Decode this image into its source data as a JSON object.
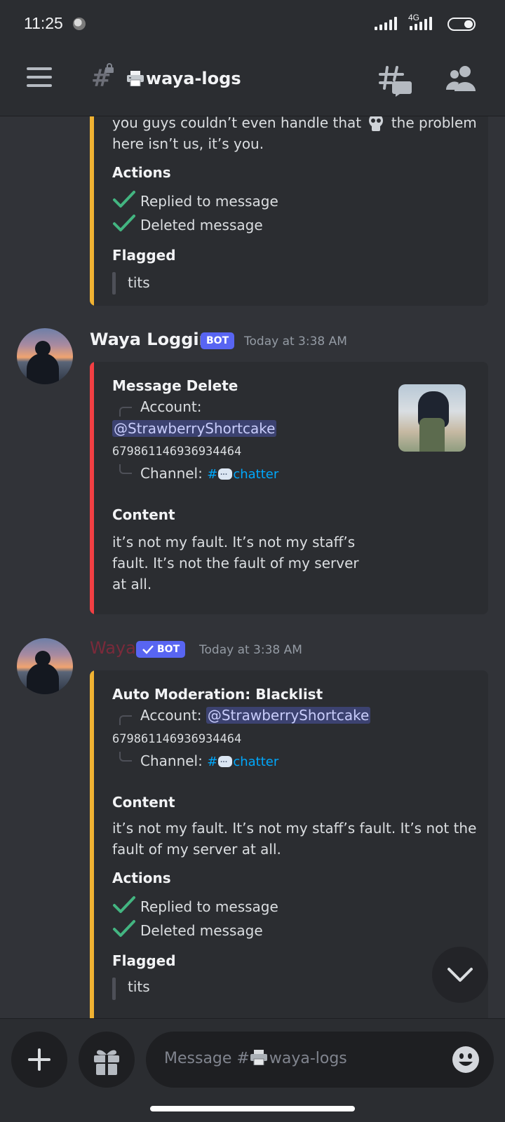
{
  "status_bar": {
    "time": "11:25",
    "network": "4G"
  },
  "header": {
    "channel_name": "waya-logs",
    "icons": [
      "menu-icon",
      "locked-channel-hash-icon",
      "printer-emoji",
      "threads-icon",
      "members-icon"
    ]
  },
  "messages": [
    {
      "partial_embed": {
        "content_tail_1": "you guys couldn’t even handle that",
        "content_tail_1b": "the problem",
        "content_tail_2": "here isn’t us, it’s you.",
        "actions_title": "Actions",
        "actions": [
          "Replied to message",
          "Deleted message"
        ],
        "flagged_title": "Flagged",
        "flagged_word": "tits",
        "bar_color": "#f0b232"
      }
    },
    {
      "author": "Waya Logging",
      "bot_tag": "BOT",
      "timestamp": "Today at 3:38 AM",
      "embed": {
        "title": "Message Delete",
        "account_label": "Account:",
        "account_mention": "@StrawberryShortcake",
        "account_id": "679861146936934464",
        "channel_label": "Channel:",
        "channel_hash": "#",
        "channel_name": "chatter",
        "content_title": "Content",
        "content_lines": [
          "it’s not my fault. It’s not my staff’s",
          "fault. It’s not the fault of my server",
          "at all."
        ],
        "bar_color": "#f23f43"
      }
    },
    {
      "author": "Waya",
      "bot_tag": "BOT",
      "timestamp": "Today at 3:38 AM",
      "embed": {
        "title": "Auto Moderation: Blacklist",
        "account_label": "Account:",
        "account_mention": "@StrawberryShortcake",
        "account_id": "679861146936934464",
        "channel_label": "Channel:",
        "channel_hash": "#",
        "channel_name": "chatter",
        "content_title": "Content",
        "content_lines": [
          "it’s not my fault. It’s not my staff’s fault. It’s not the",
          "fault of my server at all."
        ],
        "actions_title": "Actions",
        "actions": [
          "Replied to message",
          "Deleted message"
        ],
        "flagged_title": "Flagged",
        "flagged_word": "tits",
        "bar_color": "#f0b232"
      }
    }
  ],
  "composer": {
    "placeholder_prefix": "Message #",
    "placeholder_channel": "waya-logs"
  },
  "colors": {
    "background": "#313338",
    "embed_bg": "#2b2d31",
    "blurple": "#5865f2",
    "link": "#00a8fc",
    "check": "#43b581",
    "author_waya": "#7a2a3a"
  }
}
